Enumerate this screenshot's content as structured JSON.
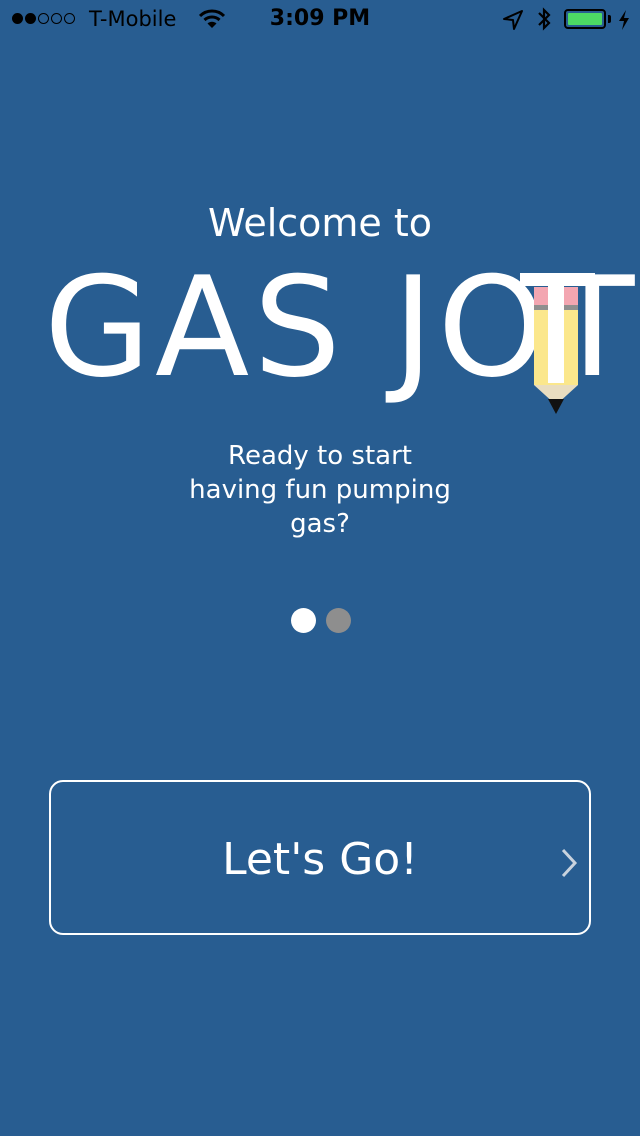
{
  "status_bar": {
    "carrier": "T-Mobile",
    "time": "3:09 PM",
    "signal_bars_filled": 2,
    "signal_bars_total": 5,
    "battery_level": 1.0,
    "battery_color": "#4cd964",
    "icons": [
      "wifi-icon",
      "location-arrow-icon",
      "bluetooth-icon",
      "battery-icon",
      "charging-bolt-icon"
    ]
  },
  "welcome": {
    "heading": "Welcome to",
    "logo_text": "GAS JOT",
    "tagline_lines": [
      "Ready to start",
      "having fun pumping",
      "gas?"
    ]
  },
  "pager": {
    "current_page": 1,
    "total_pages": 2
  },
  "cta": {
    "label": "Let's Go!",
    "icon": "chevron-right-icon"
  },
  "colors": {
    "background": "#285d91",
    "text": "#ffffff",
    "pager_inactive": "#8e8e8e",
    "pencil_body": "#fbe78c",
    "pencil_eraser": "#f3a6b1"
  }
}
